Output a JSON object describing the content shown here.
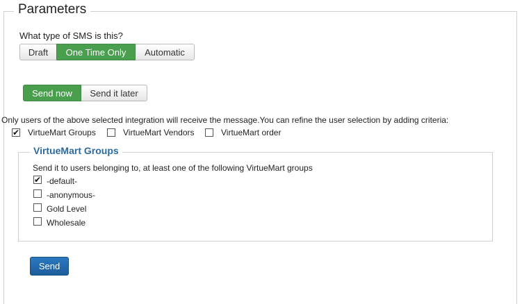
{
  "fieldset": {
    "legend": "Parameters"
  },
  "sms_type": {
    "question": "What type of SMS is this?",
    "options": [
      "Draft",
      "One Time Only",
      "Automatic"
    ],
    "selected": "One Time Only"
  },
  "timing": {
    "options": [
      "Send now",
      "Send it later"
    ],
    "selected": "Send now"
  },
  "integration_note": "Only users of the above selected integration will receive the message.You can refine the user selection by adding criteria:",
  "criteria": [
    {
      "label": "VirtueMart Groups",
      "checked": true
    },
    {
      "label": "VirtueMart Vendors",
      "checked": false
    },
    {
      "label": "VirtueMart order",
      "checked": false
    }
  ],
  "groups": {
    "title": "VirtueMart Groups",
    "description": "Send it to users belonging to, at least one of the following VirtueMart groups",
    "items": [
      {
        "label": "-default-",
        "checked": true
      },
      {
        "label": "-anonymous-",
        "checked": false
      },
      {
        "label": "Gold Level",
        "checked": false
      },
      {
        "label": "Wholesale",
        "checked": false
      }
    ]
  },
  "send_button": {
    "label": "Send"
  },
  "colors": {
    "active_green": "#4a9f4e",
    "primary_blue": "#1d5d9c",
    "section_title": "#2c6a9e"
  }
}
